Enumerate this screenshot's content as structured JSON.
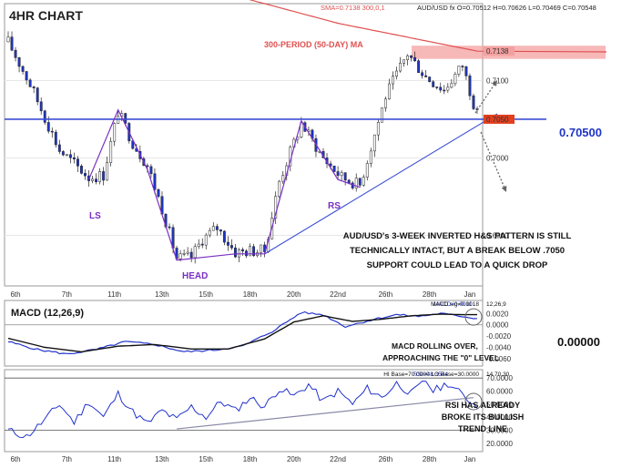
{
  "header": {
    "title": "4HR CHART",
    "sma_info": "SMA=0.7138 300,0,1",
    "ohlc_info": "AUD/USD fx O=0.70512 H=0.70626 L=0.70469 C=0.70548"
  },
  "annotations": {
    "ma_label": "300-PERIOD (50-DAY) MA",
    "ls": "LS",
    "head": "HEAD",
    "rs": "RS",
    "level": "0.70500",
    "pattern_lines": [
      "AUD/USD's 3-WEEK INVERTED H&S PATTERN IS STILL",
      "TECHNICALLY INTACT, BUT A BREAK BELOW .7050",
      "SUPPORT COULD LEAD TO A QUICK DROP"
    ],
    "macd_lines": [
      "MACD ROLLING OVER,",
      "APPROACHING THE \"0\" LEVEL"
    ],
    "macd_zero": "0.00000",
    "rsi_lines": [
      "RSI HAS ALREADY",
      "BROKE ITS BULLISH",
      "TREND LINE"
    ]
  },
  "macd_panel": {
    "title": "MACD (12,26,9)",
    "info_a": "MACD=0.0011",
    "info_b": "MACD sig=0.0018",
    "info_c": "12,26,9"
  },
  "rsi_panel": {
    "info_a": "RSI=48.3544",
    "info_b": "HI Base=70.0000 LO Base=30.0000",
    "info_c": "14,70,30"
  },
  "colors": {
    "bull": "#ffffff",
    "bear": "#1f35c8",
    "ma": "#e05050",
    "support": "#3d4fd6",
    "pattern": "#7a2fc4",
    "resistance_zone": "#f4a0a0",
    "macd": "#2233cc",
    "signal": "#111111",
    "rsi": "#2233cc"
  },
  "chart_data": [
    {
      "type": "candlestick",
      "title": "4HR CHART",
      "x": [
        "6th",
        "7th",
        "11th",
        "13th",
        "15th",
        "18th",
        "20th",
        "22nd",
        "26th",
        "28th",
        "Jan"
      ],
      "ylim": [
        0.6837,
        0.7197
      ],
      "yticks": [
        0.69,
        0.7,
        0.71
      ],
      "ytick_labels": [
        "0.6900",
        "0.7000",
        "0.7100"
      ],
      "price_labels": [
        "0.7138",
        "0.7050"
      ],
      "levels": {
        "ma_value": 0.7138,
        "support": 0.705
      },
      "last_ohlc": {
        "open": 0.70512,
        "high": 0.70626,
        "low": 0.70469,
        "close": 0.70548
      },
      "price_path": [
        [
          0,
          0.715
        ],
        [
          6,
          0.7095
        ],
        [
          14,
          0.701
        ],
        [
          22,
          0.6975
        ],
        [
          26,
          0.6978
        ],
        [
          30,
          0.706
        ],
        [
          34,
          0.702
        ],
        [
          38,
          0.699
        ],
        [
          42,
          0.6935
        ],
        [
          46,
          0.687
        ],
        [
          50,
          0.6872
        ],
        [
          53,
          0.6895
        ],
        [
          57,
          0.691
        ],
        [
          62,
          0.6878
        ],
        [
          66,
          0.688
        ],
        [
          70,
          0.688
        ],
        [
          74,
          0.697
        ],
        [
          80,
          0.7045
        ],
        [
          86,
          0.7
        ],
        [
          91,
          0.6975
        ],
        [
          96,
          0.6965
        ],
        [
          103,
          0.708
        ],
        [
          109,
          0.7135
        ],
        [
          114,
          0.7105
        ],
        [
          119,
          0.7088
        ],
        [
          124,
          0.712
        ],
        [
          128,
          0.7055
        ]
      ],
      "ma_path": [
        [
          0,
          0.7278
        ],
        [
          30,
          0.7248
        ],
        [
          60,
          0.7212
        ],
        [
          90,
          0.7174
        ],
        [
          128,
          0.7138
        ]
      ]
    },
    {
      "type": "line",
      "title": "MACD (12,26,9)",
      "ylim": [
        -0.007,
        0.004
      ],
      "yticks": [
        0.002,
        0.0,
        -0.002,
        -0.004,
        -0.006
      ],
      "ytick_labels": [
        "0.0020",
        "0.0000",
        "-0.0020",
        "-0.0040",
        "-0.0060"
      ],
      "series": [
        {
          "name": "MACD",
          "values_path": [
            [
              0,
              -0.003
            ],
            [
              8,
              -0.0044
            ],
            [
              16,
              -0.0052
            ],
            [
              24,
              -0.0044
            ],
            [
              32,
              -0.003
            ],
            [
              40,
              -0.0035
            ],
            [
              48,
              -0.0048
            ],
            [
              56,
              -0.0045
            ],
            [
              64,
              -0.0038
            ],
            [
              72,
              -0.0012
            ],
            [
              80,
              0.0022
            ],
            [
              86,
              0.0018
            ],
            [
              92,
              -0.0003
            ],
            [
              100,
              0.001
            ],
            [
              106,
              0.0018
            ],
            [
              112,
              0.0015
            ],
            [
              118,
              0.002
            ],
            [
              124,
              0.0015
            ],
            [
              128,
              0.0011
            ]
          ]
        },
        {
          "name": "MACD sig",
          "values_path": [
            [
              0,
              -0.0024
            ],
            [
              10,
              -0.004
            ],
            [
              20,
              -0.0048
            ],
            [
              30,
              -0.0038
            ],
            [
              40,
              -0.0035
            ],
            [
              50,
              -0.0043
            ],
            [
              60,
              -0.0043
            ],
            [
              70,
              -0.0025
            ],
            [
              78,
              0.0005
            ],
            [
              86,
              0.0016
            ],
            [
              94,
              0.0006
            ],
            [
              102,
              0.001
            ],
            [
              110,
              0.0016
            ],
            [
              118,
              0.0019
            ],
            [
              124,
              0.0018
            ],
            [
              128,
              0.0018
            ]
          ]
        }
      ]
    },
    {
      "type": "line",
      "title": "RSI",
      "ylim": [
        15,
        75
      ],
      "yticks": [
        70,
        60,
        50,
        40,
        30,
        20
      ],
      "ytick_labels": [
        "70.0000",
        "60.0000",
        "50.0000",
        "40.0000",
        "30.0000",
        "20.0000"
      ],
      "levels": [
        70,
        30
      ],
      "series": [
        {
          "name": "RSI",
          "values_path": [
            [
              0,
              30
            ],
            [
              5,
              25
            ],
            [
              10,
              38
            ],
            [
              14,
              50
            ],
            [
              18,
              36
            ],
            [
              22,
              52
            ],
            [
              26,
              40
            ],
            [
              30,
              58
            ],
            [
              34,
              44
            ],
            [
              38,
              35
            ],
            [
              42,
              45
            ],
            [
              46,
              38
            ],
            [
              50,
              48
            ],
            [
              54,
              40
            ],
            [
              58,
              52
            ],
            [
              62,
              45
            ],
            [
              66,
              55
            ],
            [
              70,
              48
            ],
            [
              74,
              62
            ],
            [
              78,
              56
            ],
            [
              82,
              65
            ],
            [
              86,
              52
            ],
            [
              90,
              60
            ],
            [
              94,
              50
            ],
            [
              98,
              62
            ],
            [
              102,
              55
            ],
            [
              106,
              66
            ],
            [
              110,
              58
            ],
            [
              114,
              68
            ],
            [
              116,
              60
            ],
            [
              120,
              66
            ],
            [
              124,
              57
            ],
            [
              128,
              48
            ]
          ]
        }
      ]
    }
  ]
}
